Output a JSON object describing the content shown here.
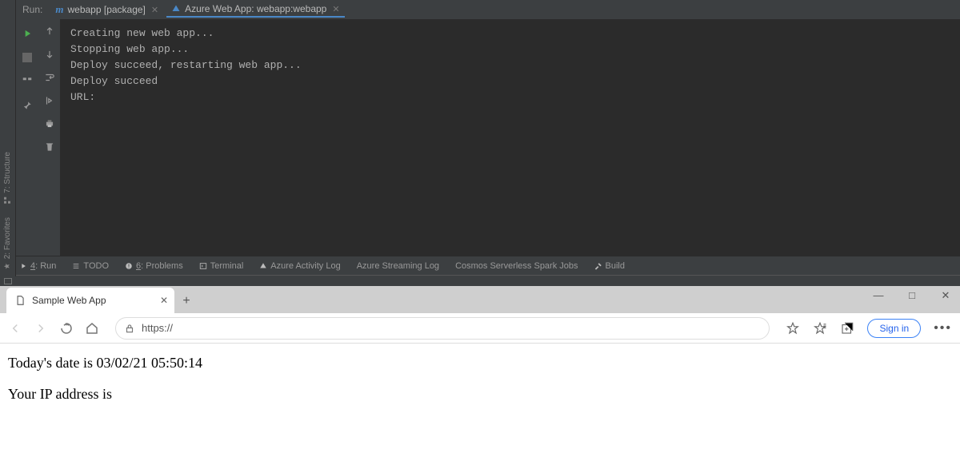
{
  "ide": {
    "run_label": "Run:",
    "tabs": [
      {
        "icon": "m",
        "label": "webapp [package]"
      },
      {
        "icon": "azure",
        "label": "Azure Web App: webapp:webapp"
      }
    ],
    "left_edge": [
      {
        "icon": "structure",
        "label": "7: Structure"
      },
      {
        "icon": "star",
        "label": "2: Favorites"
      }
    ],
    "console_lines": [
      "Creating new web app...",
      "Stopping web app...",
      "Deploy succeed, restarting web app...",
      "Deploy succeed",
      "URL:"
    ],
    "bottom_tabs": [
      {
        "icon": "play",
        "label_pre": "",
        "key": "4",
        "label_post": ": Run"
      },
      {
        "icon": "list",
        "label": "TODO"
      },
      {
        "icon": "warn",
        "label_pre": "",
        "key": "6",
        "label_post": ": Problems"
      },
      {
        "icon": "term",
        "label": "Terminal"
      },
      {
        "icon": "azure",
        "label": "Azure Activity Log"
      },
      {
        "icon": "",
        "label": "Azure Streaming Log"
      },
      {
        "icon": "",
        "label": "Cosmos Serverless Spark Jobs"
      },
      {
        "icon": "hammer",
        "label": "Build"
      }
    ]
  },
  "browser": {
    "tab_title": "Sample Web App",
    "url_text": "https://",
    "signin_label": "Sign in",
    "page_lines": [
      "Today's date is 03/02/21 05:50:14",
      "Your IP address is"
    ]
  }
}
